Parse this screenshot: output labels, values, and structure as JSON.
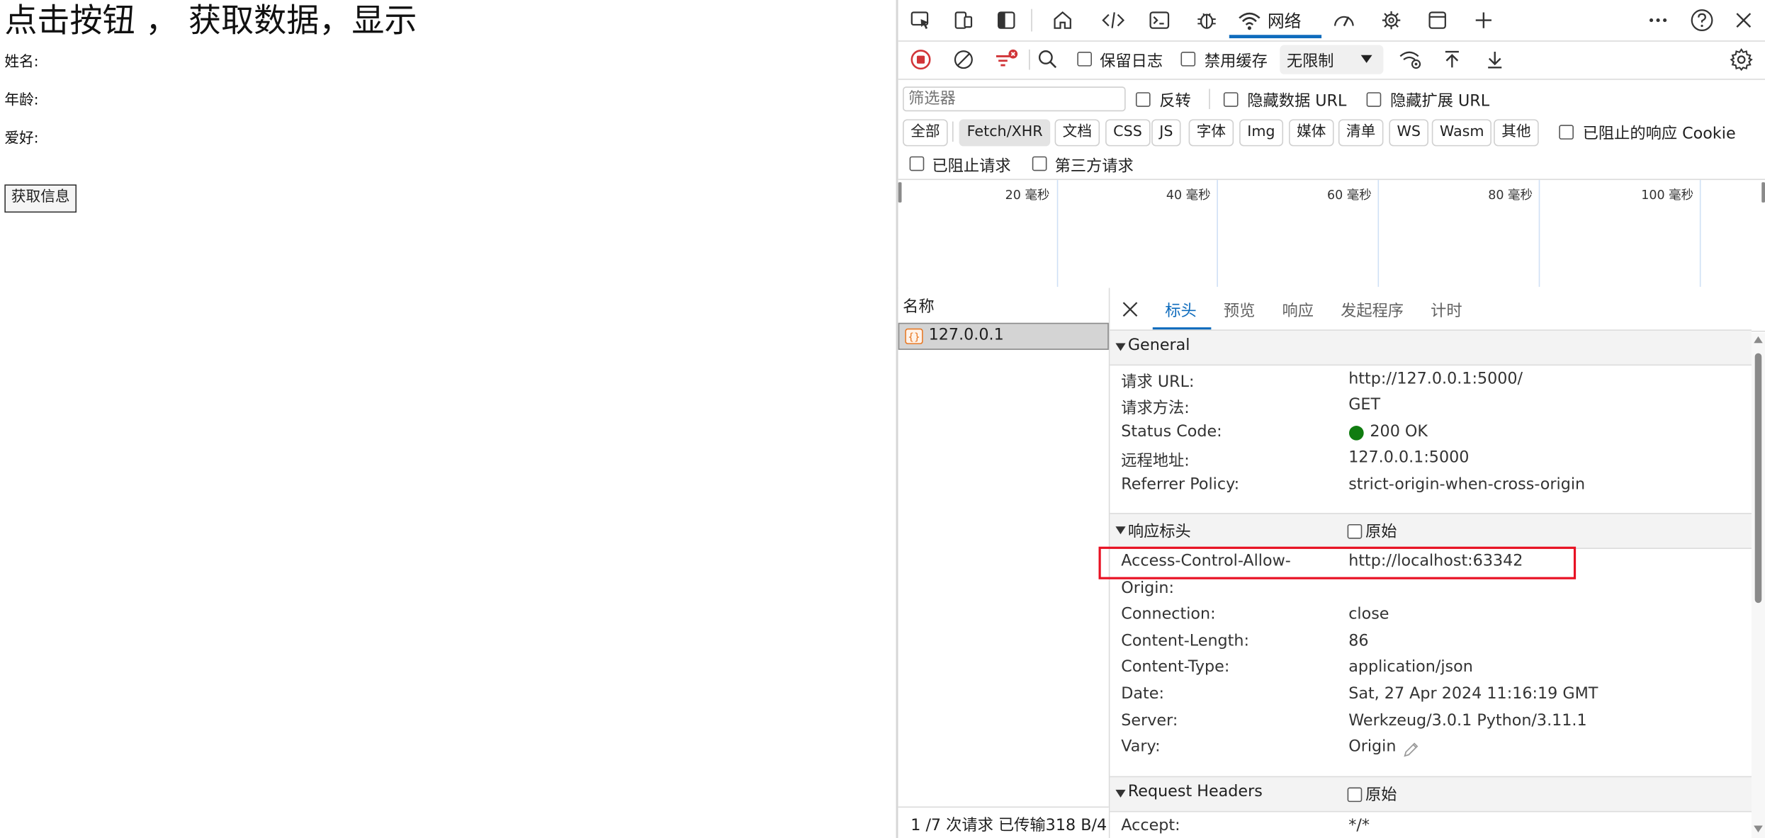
{
  "page": {
    "title": "点击按钮 ， 获取数据，显示",
    "labels": [
      "姓名:",
      "年龄:",
      "爱好:"
    ],
    "button": "获取信息"
  },
  "toolbar": {
    "network_tab": "网络"
  },
  "network_toolbar": {
    "preserve_log": "保留日志",
    "disable_cache": "禁用缓存",
    "throttling": "无限制"
  },
  "filter": {
    "placeholder": "筛选器",
    "invert": "反转",
    "hide_data_urls": "隐藏数据 URL",
    "hide_ext_urls": "隐藏扩展 URL",
    "types": [
      "全部",
      "Fetch/XHR",
      "文档",
      "CSS",
      "JS",
      "字体",
      "Img",
      "媒体",
      "清单",
      "WS",
      "Wasm",
      "其他"
    ],
    "active_type": "Fetch/XHR",
    "blocked_cookies": "已阻止的响应 Cookie",
    "blocked_requests": "已阻止请求",
    "third_party": "第三方请求"
  },
  "timeline": {
    "ticks": [
      "20 毫秒",
      "40 毫秒",
      "60 毫秒",
      "80 毫秒",
      "100 毫秒"
    ]
  },
  "request_list": {
    "header": "名称",
    "rows": [
      {
        "name": "127.0.0.1"
      }
    ],
    "status": "1 /7 次请求  已传输318 B/4"
  },
  "detail": {
    "tabs": [
      "标头",
      "预览",
      "响应",
      "发起程序",
      "计时"
    ],
    "active_tab": "标头",
    "general": {
      "title": "General",
      "rows": [
        {
          "k": "请求 URL:",
          "v": "http://127.0.0.1:5000/"
        },
        {
          "k": "请求方法:",
          "v": "GET"
        },
        {
          "k": "Status Code:",
          "v": "200 OK"
        },
        {
          "k": "远程地址:",
          "v": "127.0.0.1:5000"
        },
        {
          "k": "Referrer Policy:",
          "v": "strict-origin-when-cross-origin"
        }
      ]
    },
    "response_headers": {
      "title": "响应标头",
      "raw": "原始",
      "rows": [
        {
          "k": "Access-Control-Allow-",
          "k2": "Origin:",
          "v": "http://localhost:63342"
        },
        {
          "k": "Connection:",
          "v": "close"
        },
        {
          "k": "Content-Length:",
          "v": "86"
        },
        {
          "k": "Content-Type:",
          "v": "application/json"
        },
        {
          "k": "Date:",
          "v": "Sat, 27 Apr 2024 11:16:19 GMT"
        },
        {
          "k": "Server:",
          "v": "Werkzeug/3.0.1 Python/3.11.1"
        },
        {
          "k": "Vary:",
          "v": "Origin"
        }
      ]
    },
    "request_headers": {
      "title": "Request Headers",
      "raw": "原始",
      "rows": [
        {
          "k": "Accept:",
          "v": "*/*"
        }
      ]
    }
  },
  "colors": {
    "accent": "#0f6cbd",
    "record_red": "#d13438",
    "status_green": "#107c10",
    "highlight_box": "#e81123"
  }
}
